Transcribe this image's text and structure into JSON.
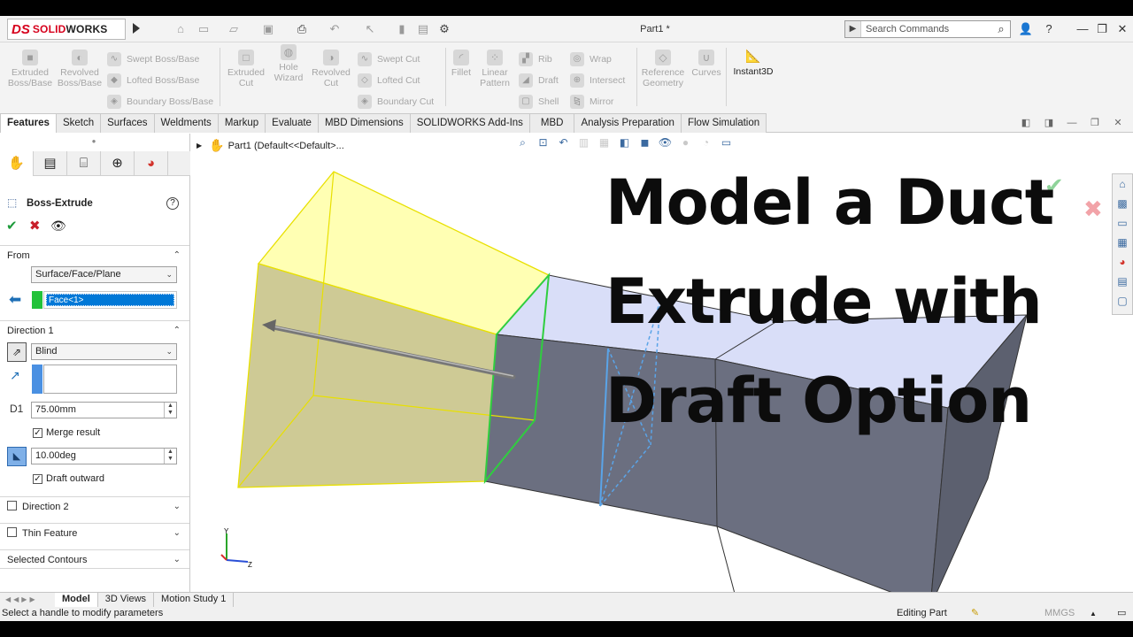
{
  "app": {
    "brand_mark": "DS",
    "brand_name_a": "SOLID",
    "brand_name_b": "WORKS",
    "document_title": "Part1 *"
  },
  "quick_access": {
    "icons": [
      "home-icon",
      "new-document-icon",
      "open-icon",
      "save-icon",
      "print-icon",
      "undo-icon",
      "select-icon",
      "rebuild-icon",
      "file-properties-icon",
      "options-icon"
    ]
  },
  "search": {
    "placeholder": "Search Commands"
  },
  "window_controls": {
    "user": "👤",
    "help": "?",
    "minimize": "—",
    "restore": "❐",
    "close": "✕"
  },
  "command_manager": {
    "extruded_boss": "Extruded Boss/Base",
    "revolved_boss": "Revolved Boss/Base",
    "swept_boss": "Swept Boss/Base",
    "lofted_boss": "Lofted Boss/Base",
    "boundary_boss": "Boundary Boss/Base",
    "extruded_cut": "Extruded Cut",
    "hole_wizard": "Hole Wizard",
    "revolved_cut": "Revolved Cut",
    "swept_cut": "Swept Cut",
    "lofted_cut": "Lofted Cut",
    "boundary_cut": "Boundary Cut",
    "fillet": "Fillet",
    "linear_pattern": "Linear Pattern",
    "rib": "Rib",
    "draft": "Draft",
    "shell": "Shell",
    "wrap": "Wrap",
    "intersect": "Intersect",
    "mirror": "Mirror",
    "reference_geometry": "Reference Geometry",
    "curves": "Curves",
    "instant3d": "Instant3D"
  },
  "tabs": [
    {
      "label": "Features",
      "active": true
    },
    {
      "label": "Sketch"
    },
    {
      "label": "Surfaces"
    },
    {
      "label": "Weldments"
    },
    {
      "label": "Markup"
    },
    {
      "label": "Evaluate"
    },
    {
      "label": "MBD Dimensions"
    },
    {
      "label": "SOLIDWORKS Add-Ins"
    },
    {
      "label": "MBD"
    },
    {
      "label": "Analysis Preparation"
    },
    {
      "label": "Flow Simulation"
    }
  ],
  "property_manager": {
    "feature_name": "Boss-Extrude",
    "from": {
      "header": "From",
      "start_condition": "Surface/Face/Plane",
      "selected_face": "Face<1>"
    },
    "direction1": {
      "header": "Direction 1",
      "end_condition": "Blind",
      "depth": "75.00mm",
      "merge_result_label": "Merge result",
      "merge_result_checked": true,
      "draft_angle": "10.00deg",
      "draft_outward_label": "Draft outward",
      "draft_outward_checked": true
    },
    "direction2": {
      "header": "Direction 2",
      "checked": false
    },
    "thin_feature": {
      "header": "Thin Feature",
      "checked": false
    },
    "selected_contours": {
      "header": "Selected Contours"
    }
  },
  "graphics": {
    "tree_label": "Part1  (Default<<Default>...",
    "overlay_title": [
      "Model a Duct",
      "Extrude with",
      "Draft Option"
    ],
    "axis_y": "Y",
    "axis_z": "Z"
  },
  "bottom_tabs": [
    {
      "label": "Model",
      "active": true
    },
    {
      "label": "3D Views"
    },
    {
      "label": "Motion Study 1"
    }
  ],
  "status_bar": {
    "message": "Select a handle to modify parameters",
    "mode": "Editing Part",
    "units": "MMGS",
    "caret": "▲"
  },
  "colors": {
    "brand_red": "#d6001c",
    "accept_green": "#1e9b3b",
    "cancel_red": "#c8202b",
    "selection_blue": "#0078d7",
    "face_highlight_green": "#23c23a",
    "preview_yellow": "#ffff9a",
    "duct_gray": "#6b6f80",
    "duct_top": "#d9def8"
  }
}
